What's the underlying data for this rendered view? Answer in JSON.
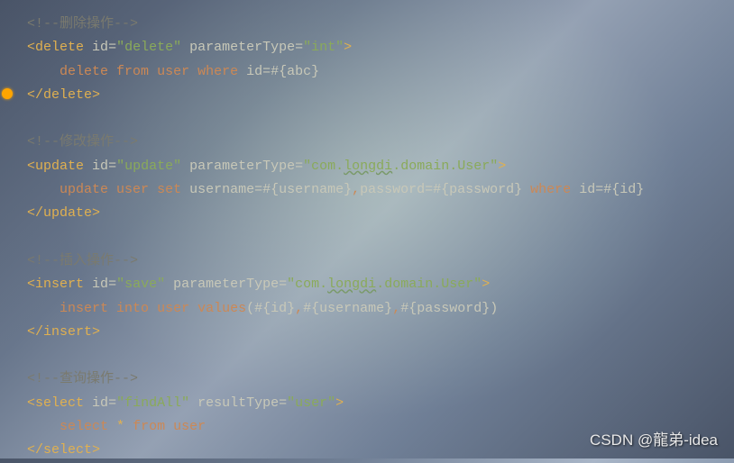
{
  "comments": {
    "delete": "<!--删除操作-->",
    "update": "<!--修改操作-->",
    "insert": "<!--插入操作-->",
    "select": "<!--查询操作-->"
  },
  "delete": {
    "open1": "<",
    "tag": "delete",
    "attr_id": "id",
    "eq": "=",
    "id_val": "\"delete\"",
    "attr_pt": "parameterType",
    "pt_val": "\"int\"",
    "close1": ">",
    "sql_kw1": "delete",
    "sql_kw2": "from",
    "sql_kw3": "user",
    "sql_kw4": "where",
    "sql_rest": " id=#{abc}",
    "close2": "</",
    "close3": ">"
  },
  "update": {
    "open1": "<",
    "tag": "update",
    "attr_id": "id",
    "eq": "=",
    "id_val": "\"update\"",
    "attr_pt": "parameterType",
    "pt_val1": "\"com.",
    "pt_val2": "longdi",
    "pt_val3": ".domain.User\"",
    "close1": ">",
    "sql_kw1": "update",
    "sql_kw2": "user",
    "sql_kw3": "set",
    "sql_rest1": " username=#{username}",
    "comma": ",",
    "sql_rest2": "password=#{password} ",
    "sql_kw4": "where",
    "sql_rest3": " id=#{id}",
    "close2": "</",
    "close3": ">"
  },
  "insert": {
    "open1": "<",
    "tag": "insert",
    "attr_id": "id",
    "eq": "=",
    "id_val": "\"save\"",
    "attr_pt": "parameterType",
    "pt_val1": "\"com.",
    "pt_val2": "longdi",
    "pt_val3": ".domain.User\"",
    "close1": ">",
    "sql_kw1": "insert",
    "sql_kw2": "into",
    "sql_kw3": "user",
    "sql_kw4": "values",
    "sql_rest1": "(#{id}",
    "comma1": ",",
    "sql_rest2": "#{username}",
    "comma2": ",",
    "sql_rest3": "#{password})",
    "close2": "</",
    "close3": ">"
  },
  "select": {
    "open1": "<",
    "tag": "select",
    "attr_id": "id",
    "eq": "=",
    "id_val": "\"findAll\"",
    "attr_rt": "resultType",
    "rt_val": "\"user\"",
    "close1": ">",
    "sql_kw1": "select",
    "star": "*",
    "sql_kw2": "from",
    "sql_kw3": "user",
    "close2": "</",
    "close3": ">"
  },
  "watermark": "CSDN @龍弟-idea"
}
